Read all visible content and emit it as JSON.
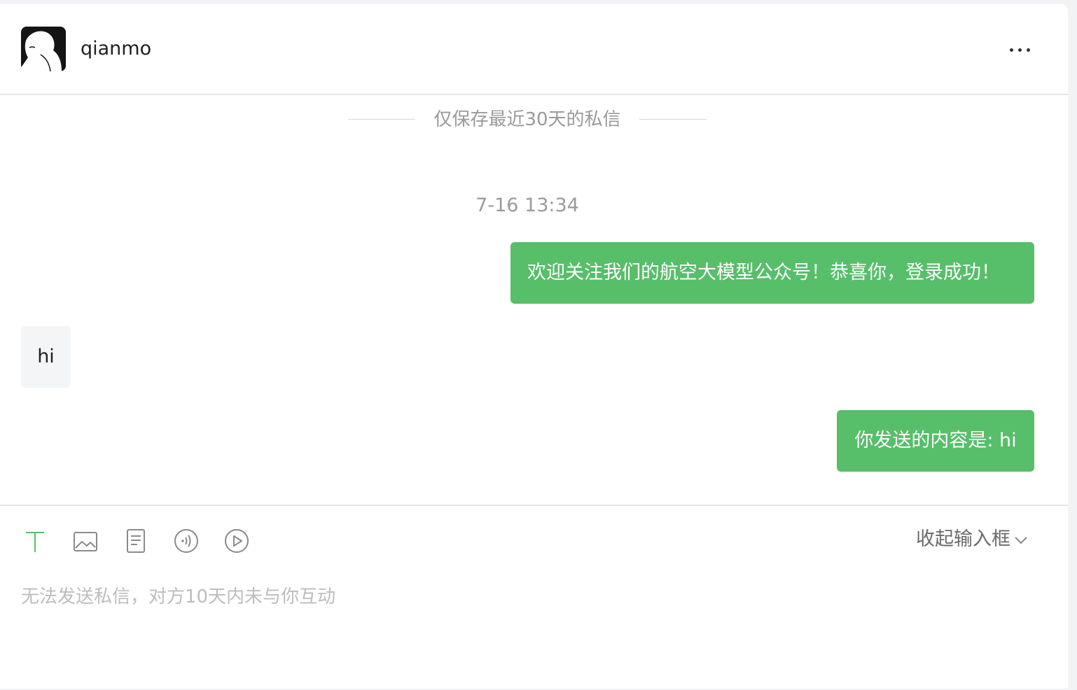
{
  "header": {
    "username": "qianmo",
    "avatar_icon": "avatar-illustration-icon",
    "more_icon": "more-dots-icon"
  },
  "notice": {
    "text": "仅保存最近30天的私信"
  },
  "messages": [
    {
      "type": "timestamp",
      "text": "7-16 13:34"
    },
    {
      "type": "outgoing",
      "text": "欢迎关注我们的航空大模型公众号！恭喜你，登录成功！"
    },
    {
      "type": "incoming",
      "text": "hi"
    },
    {
      "type": "outgoing",
      "text": "你发送的内容是: hi"
    }
  ],
  "composer": {
    "tools": [
      {
        "name": "text-tool",
        "icon": "text-icon",
        "active": true
      },
      {
        "name": "image-tool",
        "icon": "image-icon"
      },
      {
        "name": "article-tool",
        "icon": "document-icon"
      },
      {
        "name": "audio-tool",
        "icon": "audio-icon"
      },
      {
        "name": "video-tool",
        "icon": "video-icon"
      }
    ],
    "collapse_label": "收起输入框",
    "placeholder": "无法发送私信，对方10天内未与你互动"
  },
  "colors": {
    "accent": "#57be6a",
    "incoming_bg": "#f4f5f7",
    "muted_text": "#9a9a9a",
    "active_tool": "#57be6a"
  }
}
